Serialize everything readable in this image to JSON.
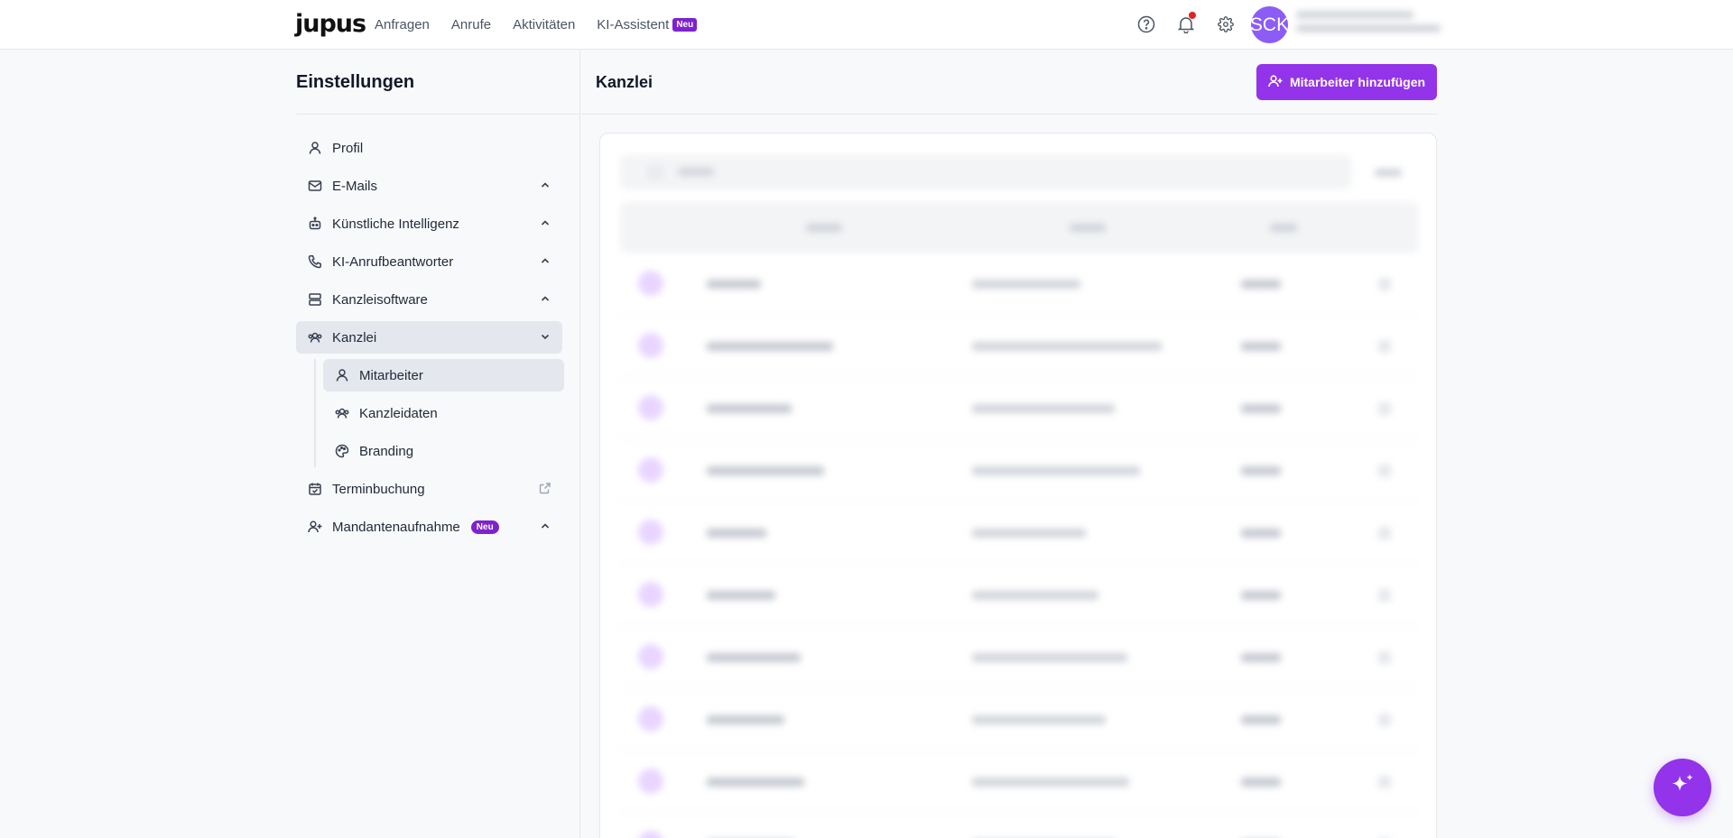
{
  "app": {
    "logo": "jupus"
  },
  "nav": {
    "items": [
      {
        "label": "Anfragen"
      },
      {
        "label": "Anrufe"
      },
      {
        "label": "Aktivitäten"
      },
      {
        "label": "KI-Assistent",
        "badge": "Neu"
      }
    ]
  },
  "topbar": {
    "icons": [
      "help-icon",
      "bell-icon",
      "gear-icon"
    ],
    "avatar_initials": "SCK",
    "notification_indicator": true
  },
  "settings": {
    "title": "Einstellungen",
    "menu": [
      {
        "label": "Profil",
        "icon": "user-icon"
      },
      {
        "label": "E-Mails",
        "icon": "mail-icon",
        "expanded": false
      },
      {
        "label": "Künstliche Intelligenz",
        "icon": "robot-icon",
        "expanded": false
      },
      {
        "label": "KI-Anrufbeantworter",
        "icon": "phone-icon",
        "expanded": false
      },
      {
        "label": "Kanzleisoftware",
        "icon": "server-icon",
        "expanded": false
      },
      {
        "label": "Kanzlei",
        "icon": "users-icon",
        "expanded": true,
        "active": true
      },
      {
        "label": "Terminbuchung",
        "icon": "calendar-check-icon",
        "external": true
      },
      {
        "label": "Mandantenaufnahme",
        "icon": "user-plus-icon",
        "badge": "Neu",
        "expanded": false
      }
    ],
    "kanzlei_submenu": [
      {
        "label": "Mitarbeiter",
        "icon": "user-icon",
        "active": true
      },
      {
        "label": "Kanzleidaten",
        "icon": "users-icon"
      },
      {
        "label": "Branding",
        "icon": "palette-icon"
      }
    ]
  },
  "main": {
    "title": "Kanzlei",
    "add_button_label": "Mitarbeiter hinzufügen"
  },
  "colors": {
    "accent": "#9333ea",
    "badge": "#7e22ce",
    "avatar": "#8b5cf6",
    "active_bg": "#e5e7ee",
    "page_bg": "#f8f9fb"
  }
}
